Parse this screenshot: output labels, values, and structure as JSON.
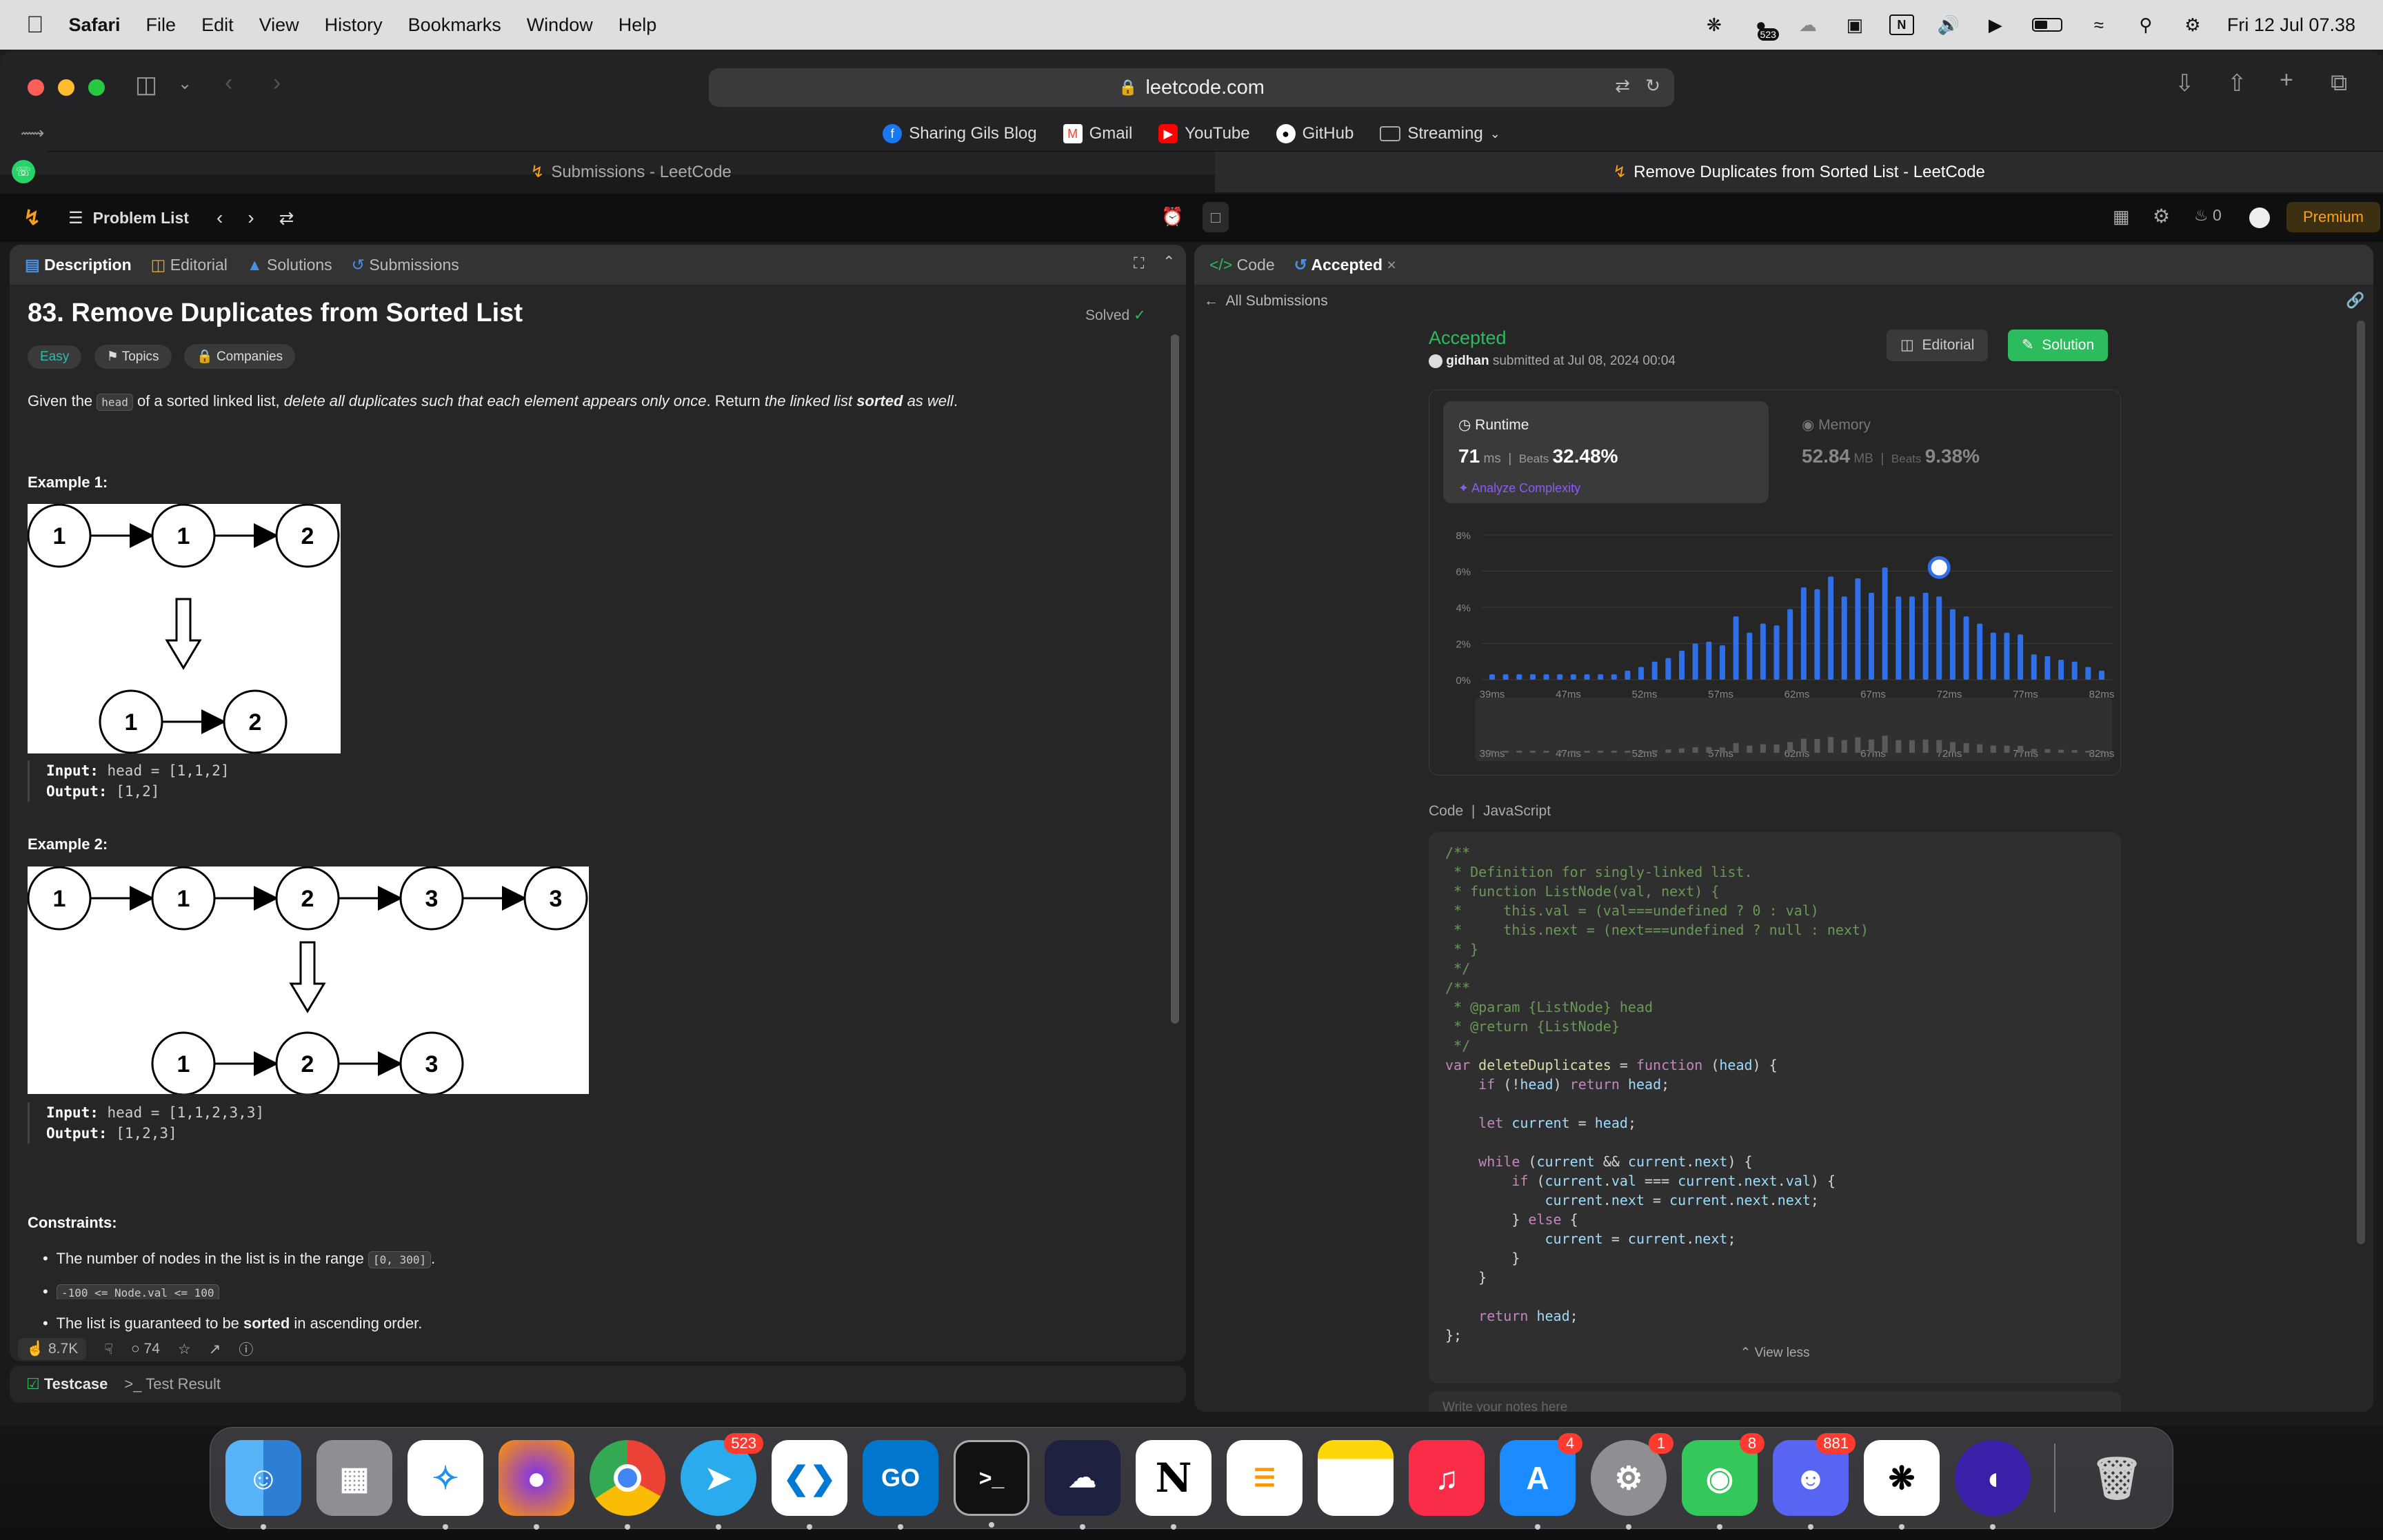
{
  "menubar": {
    "app": "Safari",
    "items": [
      "File",
      "Edit",
      "View",
      "History",
      "Bookmarks",
      "Window",
      "Help"
    ],
    "badge": "523",
    "clock": "Fri 12 Jul  07.38"
  },
  "browser": {
    "url": "leetcode.com",
    "favorites": [
      "Sharing Gils Blog",
      "Gmail",
      "YouTube",
      "GitHub",
      "Streaming"
    ],
    "tabs": [
      "Submissions - LeetCode",
      "Remove Duplicates from Sorted List - LeetCode"
    ]
  },
  "nav": {
    "problem_list": "Problem List",
    "streak": "0",
    "premium": "Premium"
  },
  "left": {
    "tabs": [
      "Description",
      "Editorial",
      "Solutions",
      "Submissions"
    ],
    "title": "83. Remove Duplicates from Sorted List",
    "solved": "Solved",
    "tags": [
      "Easy",
      "Topics",
      "Companies"
    ],
    "desc_1": "Given the",
    "desc_code": "head",
    "desc_2": "of a sorted linked list,",
    "desc_3": "delete all duplicates such that each element appears only once",
    "desc_4": ". Return",
    "desc_5": "the linked list",
    "desc_6": "sorted",
    "desc_7": "as well",
    "ex1_title": "Example 1:",
    "ex1_top": [
      "1",
      "1",
      "2"
    ],
    "ex1_bottom": [
      "1",
      "2"
    ],
    "ex1_input_label": "Input:",
    "ex1_input": "head = [1,1,2]",
    "ex1_output_label": "Output:",
    "ex1_output": "[1,2]",
    "ex2_title": "Example 2:",
    "ex2_top": [
      "1",
      "1",
      "2",
      "3",
      "3"
    ],
    "ex2_bottom": [
      "1",
      "2",
      "3"
    ],
    "ex2_input_label": "Input:",
    "ex2_input": "head = [1,1,2,3,3]",
    "ex2_output_label": "Output:",
    "ex2_output": "[1,2,3]",
    "constraints_title": "Constraints:",
    "c1": "The number of nodes in the list is in the range",
    "c1_code": "[0, 300]",
    "c2_code": "-100 <= Node.val <= 100",
    "c3_a": "The list is guaranteed to be",
    "c3_b": "sorted",
    "c3_c": "in ascending order.",
    "likes": "8.7K",
    "comments": "74",
    "testcase": "Testcase",
    "test_result": "Test Result"
  },
  "right": {
    "tabs": [
      "Code",
      "Accepted"
    ],
    "all_submissions": "All Submissions",
    "status": "Accepted",
    "user": "gidhan",
    "submitted": "submitted at Jul 08, 2024 00:04",
    "editorial_btn": "Editorial",
    "solution_btn": "Solution",
    "runtime_label": "Runtime",
    "runtime_value": "71",
    "runtime_unit": "ms",
    "beats_label": "Beats",
    "runtime_beats": "32.48%",
    "analyze": "Analyze Complexity",
    "memory_label": "Memory",
    "memory_value": "52.84",
    "memory_unit": "MB",
    "memory_beats": "9.38%",
    "code_label": "Code",
    "lang": "JavaScript",
    "view_less": "View less",
    "notes_placeholder": "Write your notes here"
  },
  "chart_data": {
    "type": "bar",
    "title": "Runtime distribution",
    "y_ticks": [
      "0%",
      "2%",
      "4%",
      "6%",
      "8%"
    ],
    "ylim": [
      0,
      8
    ],
    "x_ticks": [
      "39ms",
      "47ms",
      "52ms",
      "57ms",
      "62ms",
      "67ms",
      "72ms",
      "77ms",
      "82ms"
    ],
    "values": [
      0.3,
      0.3,
      0.3,
      0.3,
      0.3,
      0.3,
      0.3,
      0.3,
      0.3,
      0.3,
      0.5,
      0.7,
      1.0,
      1.2,
      1.6,
      2.0,
      2.1,
      1.9,
      3.5,
      2.6,
      3.1,
      3.0,
      3.9,
      5.1,
      5.0,
      5.7,
      4.6,
      5.6,
      4.8,
      6.2,
      4.6,
      4.6,
      4.8,
      4.6,
      3.9,
      3.5,
      3.1,
      2.6,
      2.6,
      2.5,
      1.4,
      1.3,
      1.1,
      1.0,
      0.7,
      0.5
    ],
    "highlight_index": 33
  },
  "dock": {
    "badges": {
      "telegram": "523",
      "appstore": "4",
      "settings": "1",
      "messages": "8",
      "discord": "881"
    }
  }
}
